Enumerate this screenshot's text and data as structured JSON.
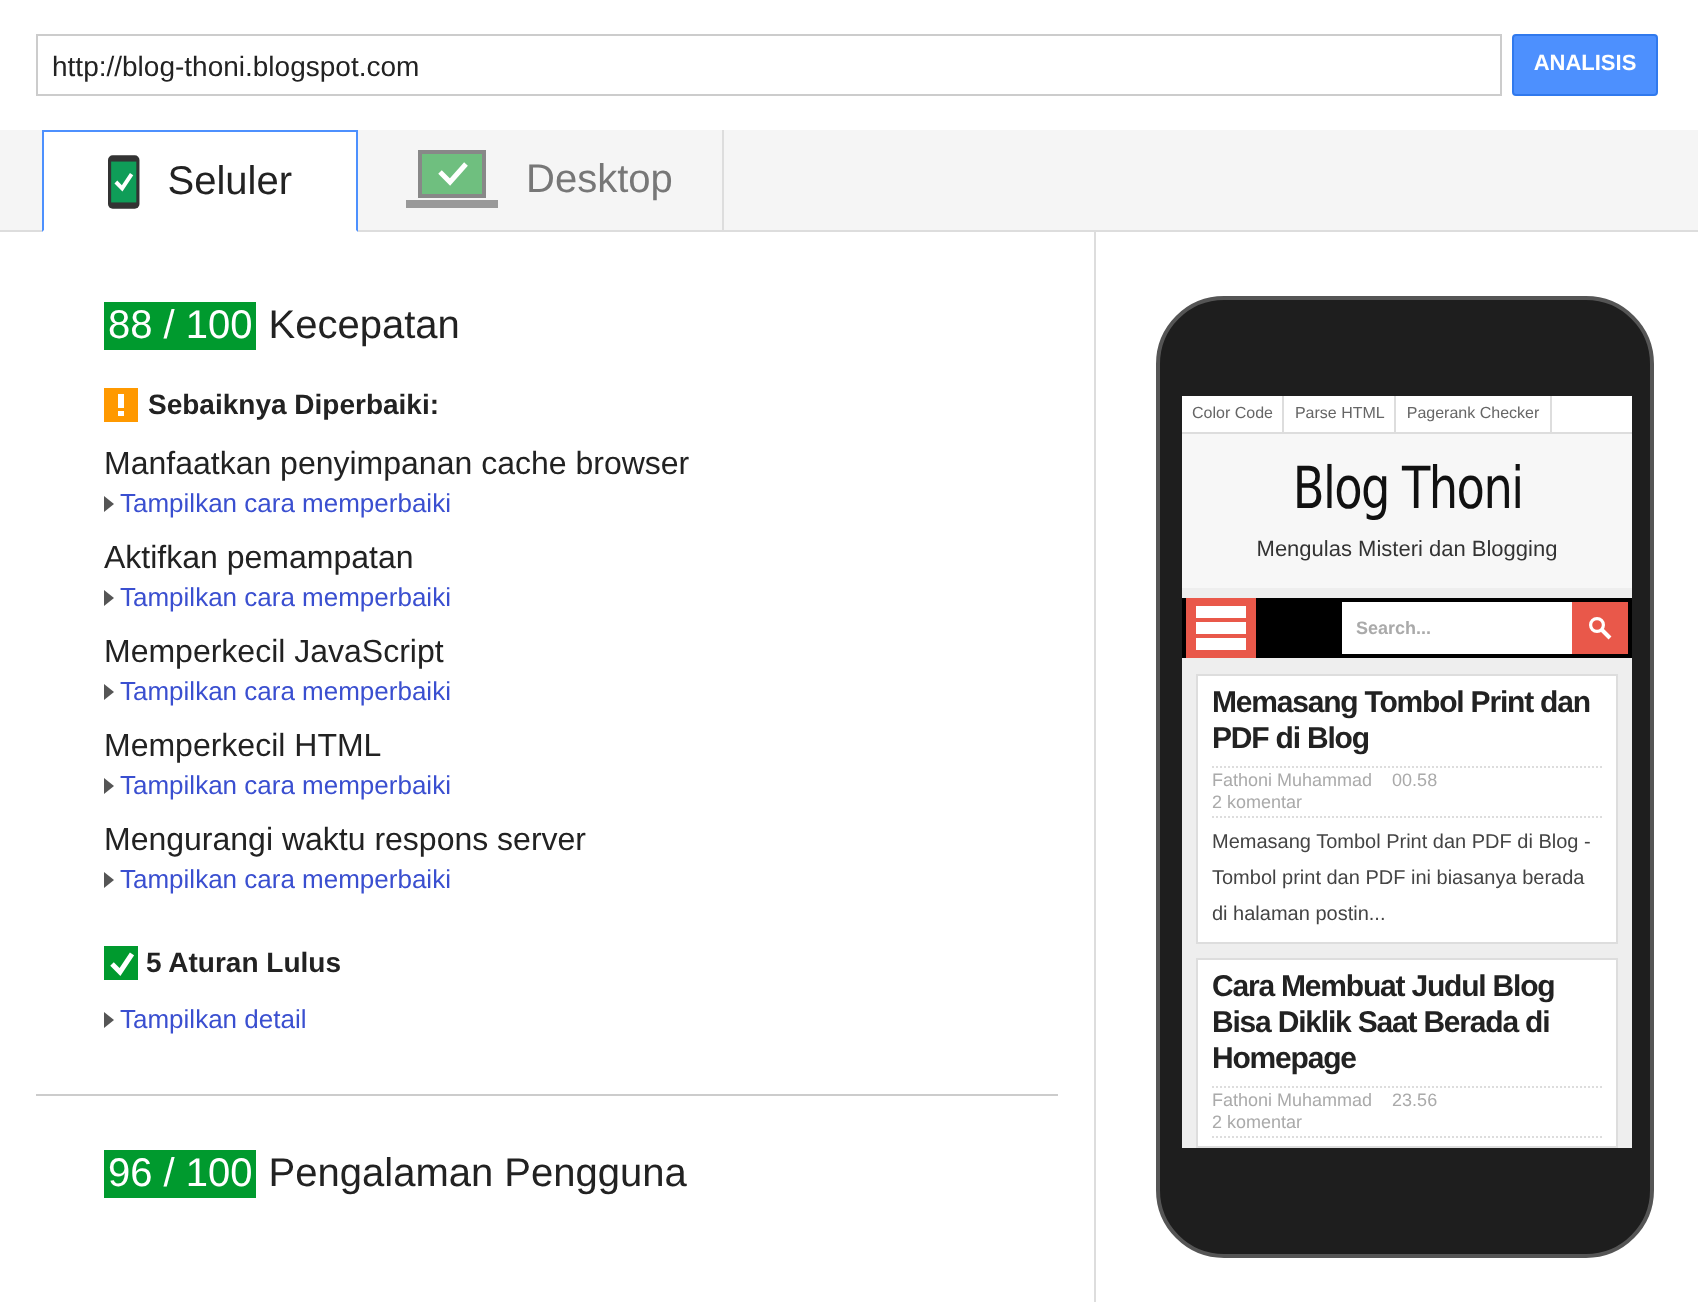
{
  "url_field": {
    "value": "http://blog-thoni.blogspot.com"
  },
  "analyze_button": "ANALISIS",
  "tabs": [
    {
      "label": "Seluler",
      "kind": "phone",
      "selected": true
    },
    {
      "label": "Desktop",
      "kind": "desktop",
      "selected": false
    }
  ],
  "sections": [
    {
      "score": "88 / 100",
      "title": "Kecepatan",
      "warning": {
        "title": "Sebaiknya Diperbaiki:",
        "items": [
          {
            "title": "Manfaatkan penyimpanan cache browser",
            "link": "Tampilkan cara memperbaiki"
          },
          {
            "title": "Aktifkan pemampatan",
            "link": "Tampilkan cara memperbaiki"
          },
          {
            "title": "Memperkecil JavaScript",
            "link": "Tampilkan cara memperbaiki"
          },
          {
            "title": "Memperkecil HTML",
            "link": "Tampilkan cara memperbaiki"
          },
          {
            "title": "Mengurangi waktu respons server",
            "link": "Tampilkan cara memperbaiki"
          }
        ]
      },
      "passed": {
        "title": "5 Aturan Lulus",
        "link": "Tampilkan detail"
      }
    },
    {
      "score": "96 / 100",
      "title": "Pengalaman Pengguna"
    }
  ],
  "phone_preview": {
    "nav_links": [
      "Color Code",
      "Parse HTML",
      "Pagerank Checker"
    ],
    "blog_title": "Blog Thoni",
    "blog_subtitle": "Mengulas Misteri dan Blogging",
    "search_placeholder": "Search...",
    "posts": [
      {
        "title": "Memasang Tombol Print dan PDF di Blog",
        "author": "Fathoni Muhammad",
        "time": "00.58",
        "comments": "2 komentar",
        "excerpt": "Memasang Tombol Print dan PDF di Blog - Tombol print dan PDF ini biasanya berada di halaman postin..."
      },
      {
        "title": "Cara Membuat Judul Blog Bisa Diklik Saat Berada di Homepage",
        "author": "Fathoni Muhammad",
        "time": "23.56",
        "comments": "2 komentar"
      }
    ]
  }
}
